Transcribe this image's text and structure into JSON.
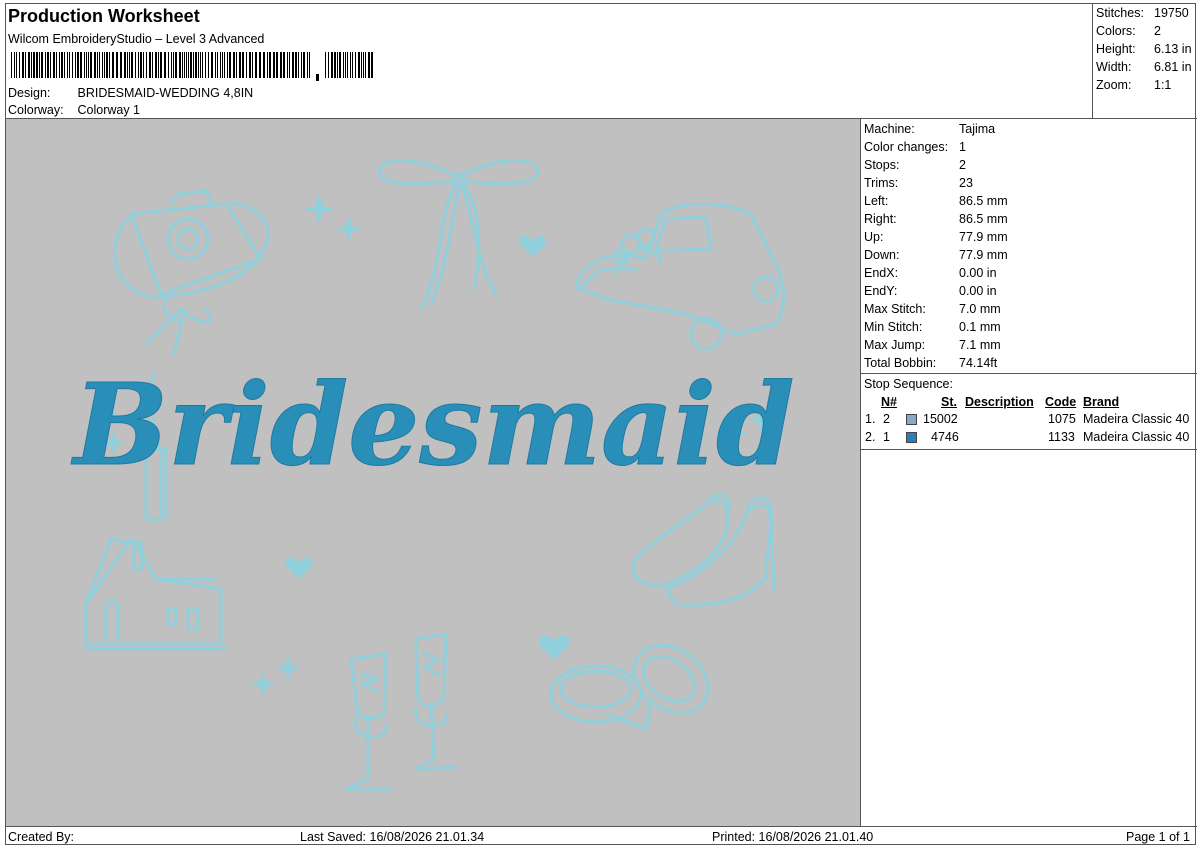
{
  "header": {
    "title": "Production Worksheet",
    "software": "Wilcom EmbroideryStudio – Level 3 Advanced",
    "design_label": "Design:",
    "design_value": "BRIDESMAID-WEDDING 4,8IN",
    "colorway_label": "Colorway:",
    "colorway_value": "Colorway 1"
  },
  "summary": {
    "stitches_label": "Stitches:",
    "stitches": "19750",
    "colors_label": "Colors:",
    "colors": "2",
    "height_label": "Height:",
    "height": "6.13 in",
    "width_label": "Width:",
    "width": "6.81 in",
    "zoom_label": "Zoom:",
    "zoom": "1:1"
  },
  "design": {
    "text": "Bridesmaid",
    "thread_light": "#8fd0dc",
    "thread_dark": "#2a8fb8",
    "background": "#c0c0c0"
  },
  "machine": [
    {
      "label": "Machine:",
      "value": "Tajima"
    },
    {
      "label": "Color changes:",
      "value": "1"
    },
    {
      "label": "Stops:",
      "value": "2"
    },
    {
      "label": "Trims:",
      "value": "23"
    },
    {
      "label": "Left:",
      "value": "86.5 mm"
    },
    {
      "label": "Right:",
      "value": "86.5 mm"
    },
    {
      "label": "Up:",
      "value": "77.9 mm"
    },
    {
      "label": "Down:",
      "value": "77.9 mm"
    },
    {
      "label": "EndX:",
      "value": "0.00 in"
    },
    {
      "label": "EndY:",
      "value": "0.00 in"
    },
    {
      "label": "Max Stitch:",
      "value": "7.0 mm"
    },
    {
      "label": "Min Stitch:",
      "value": "0.1 mm"
    },
    {
      "label": "Max Jump:",
      "value": "7.1 mm"
    },
    {
      "label": "Total Bobbin:",
      "value": "74.14ft"
    }
  ],
  "stop_sequence": {
    "title": "Stop Sequence:",
    "headers": {
      "n": "N#",
      "st": "St.",
      "description": "Description",
      "code": "Code",
      "brand": "Brand"
    },
    "rows": [
      {
        "index": "1.",
        "n": "2",
        "color": "#8aa8c8",
        "st": "15002",
        "description": "",
        "code": "1075",
        "brand": "Madeira Classic 40"
      },
      {
        "index": "2.",
        "n": "1",
        "color": "#2a7fb8",
        "st": "4746",
        "description": "",
        "code": "1133",
        "brand": "Madeira Classic 40"
      }
    ]
  },
  "footer": {
    "created_by": "Created By:",
    "last_saved": "Last Saved: 16/08/2026 21.01.34",
    "printed": "Printed: 16/08/2026 21.01.40",
    "page": "Page 1 of 1"
  }
}
